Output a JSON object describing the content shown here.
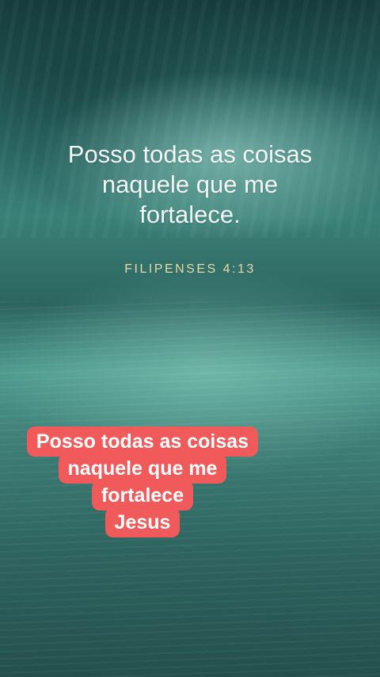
{
  "story": {
    "verse_lines": [
      "Posso todas as coisas",
      "naquele que me",
      "fortalece."
    ],
    "reference": "FILIPENSES 4:13",
    "caption_lines": [
      "Posso todas as coisas",
      "naquele que me",
      "fortalece",
      "Jesus"
    ]
  },
  "colors": {
    "caption_background": "#f05a5a",
    "reference_text": "#e8d9a6",
    "verse_text": "#f2f7f5"
  }
}
